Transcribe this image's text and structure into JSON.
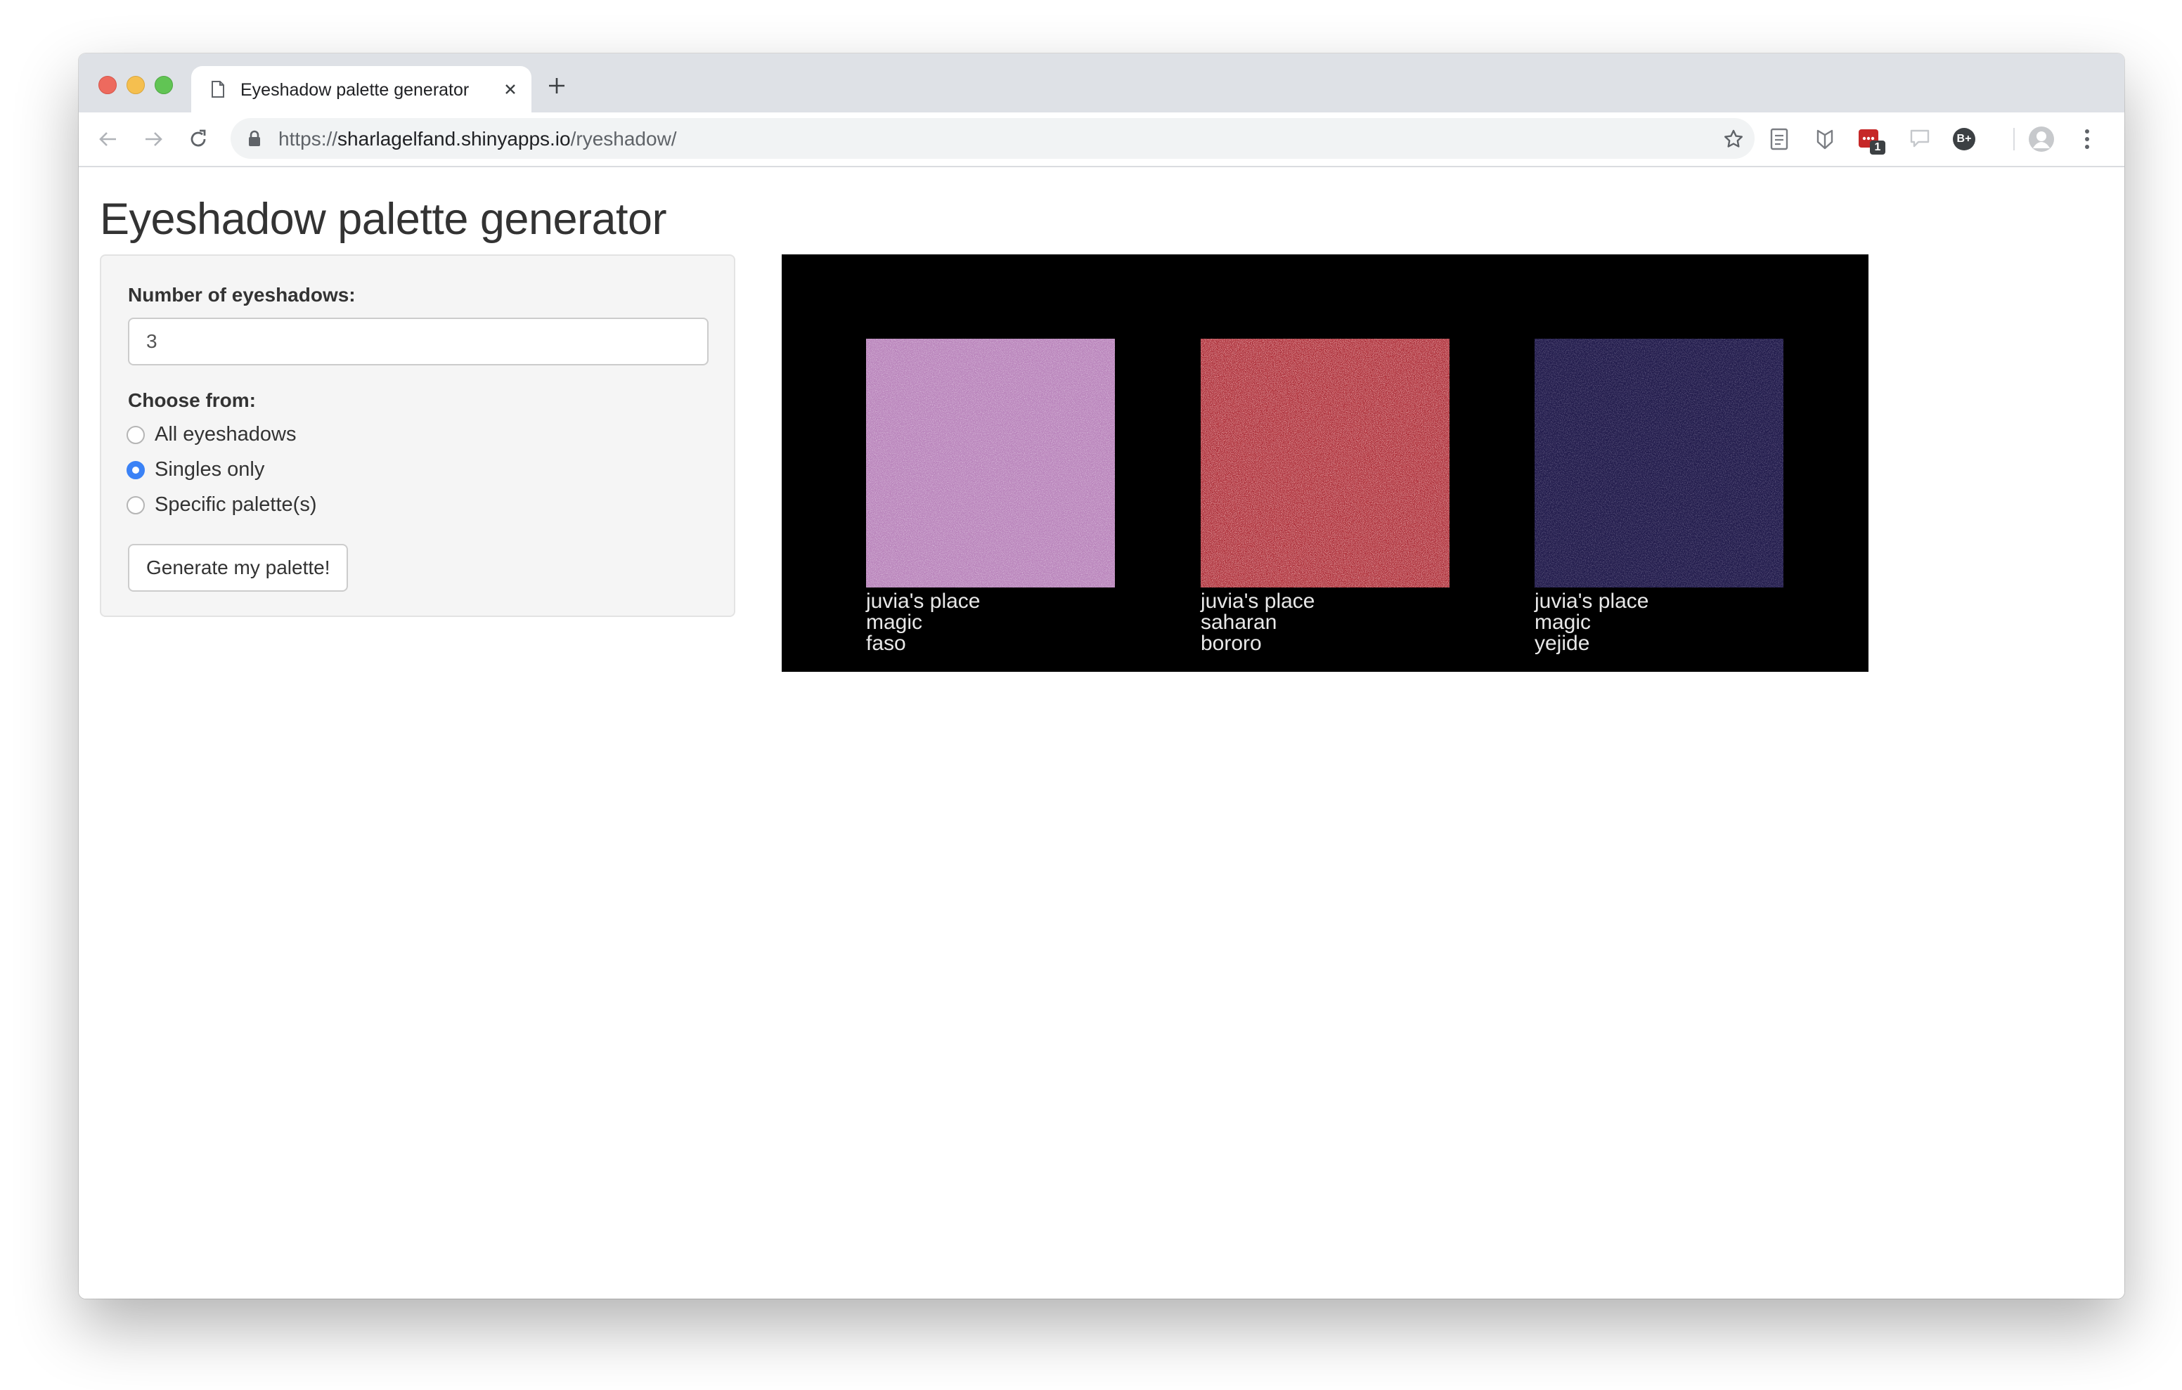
{
  "browser": {
    "tab_title": "Eyeshadow palette generator",
    "url_scheme": "https://",
    "url_host": "sharlagelfand.shinyapps.io",
    "url_path": "/ryeshadow/",
    "extension_badge": "1",
    "extension_bplus_label": "B+",
    "icons": [
      "back-arrow-icon",
      "forward-arrow-icon",
      "reload-icon",
      "lock-icon",
      "star-icon",
      "page-icon",
      "close-icon",
      "plus-icon",
      "kebab-menu-icon",
      "profile-avatar-icon"
    ]
  },
  "page": {
    "title": "Eyeshadow palette generator"
  },
  "sidebar": {
    "number_label": "Number of eyeshadows:",
    "number_value": "3",
    "choose_label": "Choose from:",
    "options": [
      {
        "label": "All eyeshadows",
        "checked": false
      },
      {
        "label": "Singles only",
        "checked": true
      },
      {
        "label": "Specific palette(s)",
        "checked": false
      }
    ],
    "generate_label": "Generate my palette!"
  },
  "palette": {
    "background": "#000000",
    "swatches": [
      {
        "brand": "juvia's place",
        "palette": "magic",
        "shade": "faso",
        "color": "#b57fb8",
        "texture": "matte"
      },
      {
        "brand": "juvia's place",
        "palette": "saharan",
        "shade": "bororo",
        "color": "#b7363d",
        "texture": "glitter"
      },
      {
        "brand": "juvia's place",
        "palette": "magic",
        "shade": "yejide",
        "color": "#231b4d",
        "texture": "matte"
      }
    ]
  },
  "colors": {
    "accent": "#3b82f6",
    "tabstrip": "#dee1e6",
    "omnibox": "#f1f3f4",
    "sidebar_bg": "#f5f5f5",
    "title_text": "#333333"
  }
}
